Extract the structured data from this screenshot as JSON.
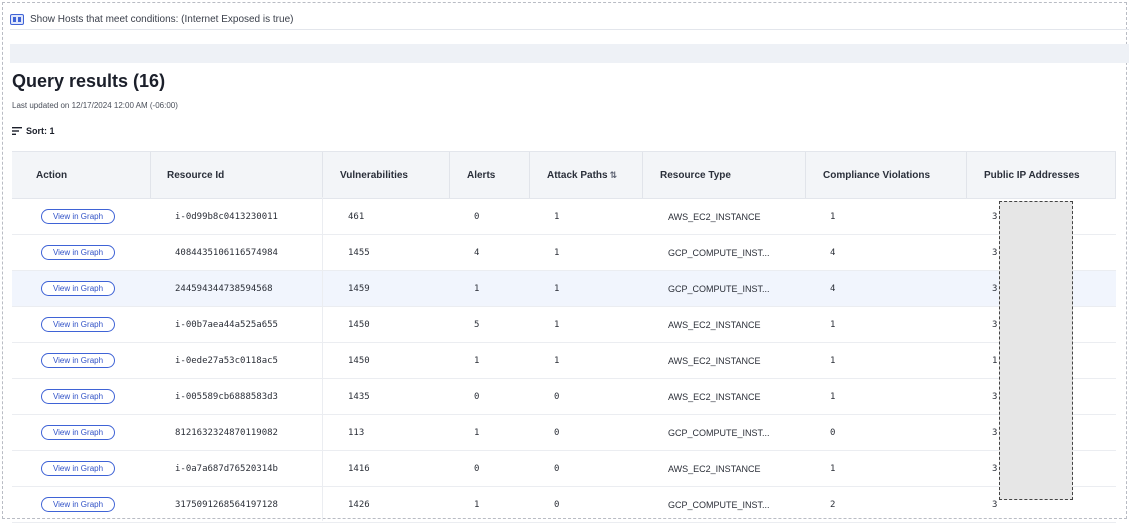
{
  "conditions_bar": {
    "text": "Show Hosts that meet conditions: (Internet Exposed is true)",
    "icon": "filter-icon"
  },
  "results": {
    "title": "Query results (16)",
    "last_updated": "Last updated on 12/17/2024 12:00 AM (-06:00)",
    "sort_label": "Sort: 1"
  },
  "table": {
    "columns": [
      "Action",
      "Resource Id",
      "Vulnerabilities",
      "Alerts",
      "Attack Paths",
      "Resource Type",
      "Compliance Violations",
      "Public IP Addresses"
    ],
    "sort_indicator": "⇅",
    "action_label": "View in Graph",
    "rows": [
      {
        "id": "i-0d99b8c0413230011",
        "vulns": "461",
        "alerts": "0",
        "paths": "1",
        "type": "AWS_EC2_INSTANCE",
        "compliance": "1",
        "ip": "3"
      },
      {
        "id": "4084435106116574984",
        "vulns": "1455",
        "alerts": "4",
        "paths": "1",
        "type": "GCP_COMPUTE_INST...",
        "compliance": "4",
        "ip": "3"
      },
      {
        "id": "244594344738594568",
        "vulns": "1459",
        "alerts": "1",
        "paths": "1",
        "type": "GCP_COMPUTE_INST...",
        "compliance": "4",
        "ip": "3"
      },
      {
        "id": "i-00b7aea44a525a655",
        "vulns": "1450",
        "alerts": "5",
        "paths": "1",
        "type": "AWS_EC2_INSTANCE",
        "compliance": "1",
        "ip": "3"
      },
      {
        "id": "i-0ede27a53c0118ac5",
        "vulns": "1450",
        "alerts": "1",
        "paths": "1",
        "type": "AWS_EC2_INSTANCE",
        "compliance": "1",
        "ip": "1"
      },
      {
        "id": "i-005589cb6888583d3",
        "vulns": "1435",
        "alerts": "0",
        "paths": "0",
        "type": "AWS_EC2_INSTANCE",
        "compliance": "1",
        "ip": "3"
      },
      {
        "id": "8121632324870119082",
        "vulns": "113",
        "alerts": "1",
        "paths": "0",
        "type": "GCP_COMPUTE_INST...",
        "compliance": "0",
        "ip": "3"
      },
      {
        "id": "i-0a7a687d76520314b",
        "vulns": "1416",
        "alerts": "0",
        "paths": "0",
        "type": "AWS_EC2_INSTANCE",
        "compliance": "1",
        "ip": "3"
      },
      {
        "id": "3175091268564197128",
        "vulns": "1426",
        "alerts": "1",
        "paths": "0",
        "type": "GCP_COMPUTE_INST...",
        "compliance": "2",
        "ip": "3"
      }
    ],
    "highlighted_row": 2
  },
  "colors": {
    "accent": "#3f63d6",
    "header_bg": "#f3f5f8",
    "highlight_row": "#f1f5fd"
  }
}
